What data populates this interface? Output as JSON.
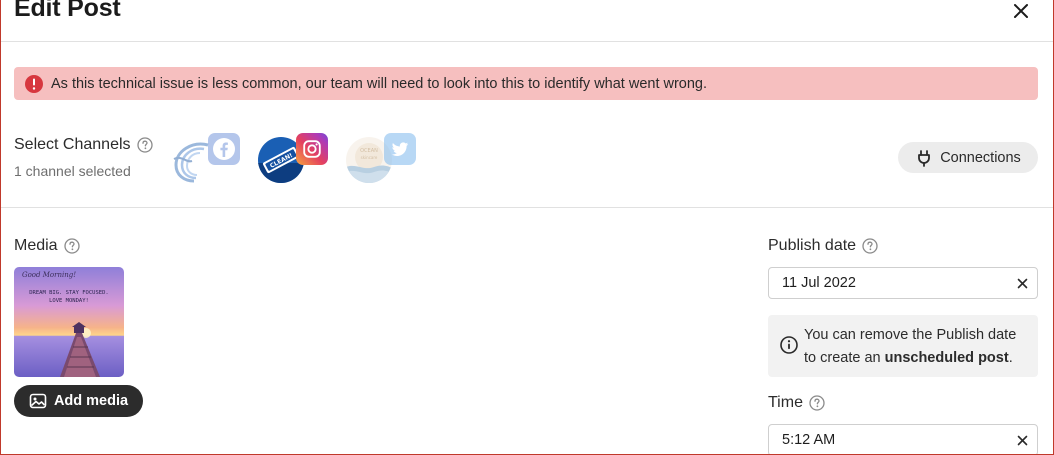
{
  "header": {
    "title": "Edit Post"
  },
  "alert": {
    "message": "As this technical issue is less common, our team will need to look into this to identify what went wrong."
  },
  "channels": {
    "label": "Select Channels",
    "selected_text": "1 channel selected",
    "items": [
      {
        "network": "facebook",
        "badge_icon": "facebook-icon",
        "badge_color": "#6b8fd8",
        "selected": false
      },
      {
        "network": "instagram",
        "badge_icon": "instagram-icon",
        "badge_color": "#d3348c",
        "selected": true
      },
      {
        "network": "twitter",
        "badge_icon": "twitter-icon",
        "badge_color": "#7fb9ee",
        "selected": false
      }
    ],
    "connections_label": "Connections"
  },
  "media": {
    "label": "Media",
    "thumbnail_text": [
      "Good Morning!",
      "DREAM BIG. STAY FOCUSED.",
      "LOVE MONDAY!"
    ],
    "add_label": "Add media"
  },
  "publish": {
    "label": "Publish date",
    "value": "11 Jul 2022",
    "info_line1": "You can remove the Publish date",
    "info_line2_prefix": "to create an ",
    "info_line2_bold": "unscheduled post",
    "info_line2_suffix": "."
  },
  "time": {
    "label": "Time",
    "value": "5:12 AM"
  },
  "colors": {
    "alert_bg": "#f6bfbf",
    "alert_icon": "#d7373f",
    "primary_button": "#2c2c2c"
  }
}
